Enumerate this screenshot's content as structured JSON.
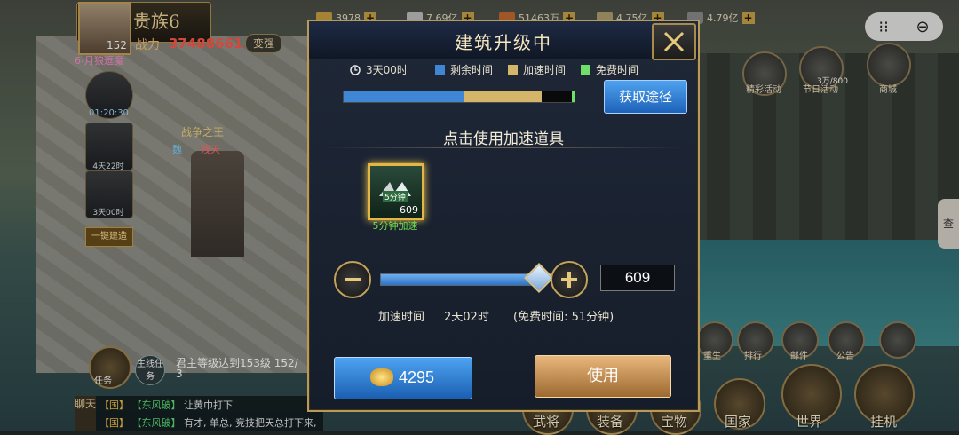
{
  "player": {
    "rank": "贵族6",
    "power_label": "战力",
    "power": "37488661",
    "level": "152",
    "change_label": "变强",
    "alliance": "6-月狼逗魔"
  },
  "resources": [
    {
      "value": "3978",
      "icon": "wood-icon",
      "color": "#c9a040"
    },
    {
      "value": "7.69亿",
      "icon": "coin-icon",
      "color": "#c0c0c0"
    },
    {
      "value": "51463万",
      "icon": "food-icon",
      "color": "#c56a30"
    },
    {
      "value": "4.75亿",
      "icon": "stone-icon",
      "color": "#b0a070"
    },
    {
      "value": "4.79亿",
      "icon": "iron-icon",
      "color": "#8a8a8a"
    }
  ],
  "left_panel": {
    "timer1": "01:20:30",
    "timer2": "4天22时",
    "timer3": "3天00时",
    "build_all": "一键建造",
    "war_king": "战争之王",
    "war_name1": "魏",
    "war_name2": "残天"
  },
  "right_panel": {
    "event_label": "精彩活动",
    "festival_label": "节日活动",
    "mall_label": "商城",
    "count": "3万/800",
    "side_tab": "查"
  },
  "bottom_icons": [
    {
      "label": "重生"
    },
    {
      "label": "排行"
    },
    {
      "label": "邮件"
    },
    {
      "label": "公告"
    }
  ],
  "bottom_nav": [
    {
      "label": "武将"
    },
    {
      "label": "装备"
    },
    {
      "label": "宝物"
    },
    {
      "label": "国家"
    },
    {
      "label": "世界"
    },
    {
      "label": "挂机"
    }
  ],
  "quest": {
    "task_label": "任务",
    "main_label": "主线任务",
    "text": "君主等级达到153级  152/",
    "num": "3"
  },
  "chat": {
    "tab_label": "聊天",
    "lines": [
      {
        "channel": "【国】",
        "name": "【东风破】",
        "text": "让黄巾打下"
      },
      {
        "channel": "【国】",
        "name": "【东风破】",
        "text": "有才, 单总, 竞技把天总打下来,"
      }
    ]
  },
  "dialog": {
    "title": "建筑升级中",
    "remaining_total": "3天00时",
    "legend": [
      {
        "label": "剩余时间",
        "color": "#3f86d4"
      },
      {
        "label": "加速时间",
        "color": "#d4b56a"
      },
      {
        "label": "免费时间",
        "color": "#6ee06a"
      }
    ],
    "progress": {
      "remaining_fraction": 0.52,
      "speedup_fraction": 0.34,
      "free_fraction": 0.01
    },
    "source_button": "获取途径",
    "section_title": "点击使用加速道具",
    "item": {
      "tag": "5分钟",
      "count": "609",
      "name": "5分钟加速"
    },
    "slider_fraction": 1.0,
    "quantity": "609",
    "speed_label": "加速时间",
    "speed_value": "2天02时",
    "free_time": "(免费时间: 51分钟)",
    "gold_value": "4295",
    "use_button": "使用"
  }
}
